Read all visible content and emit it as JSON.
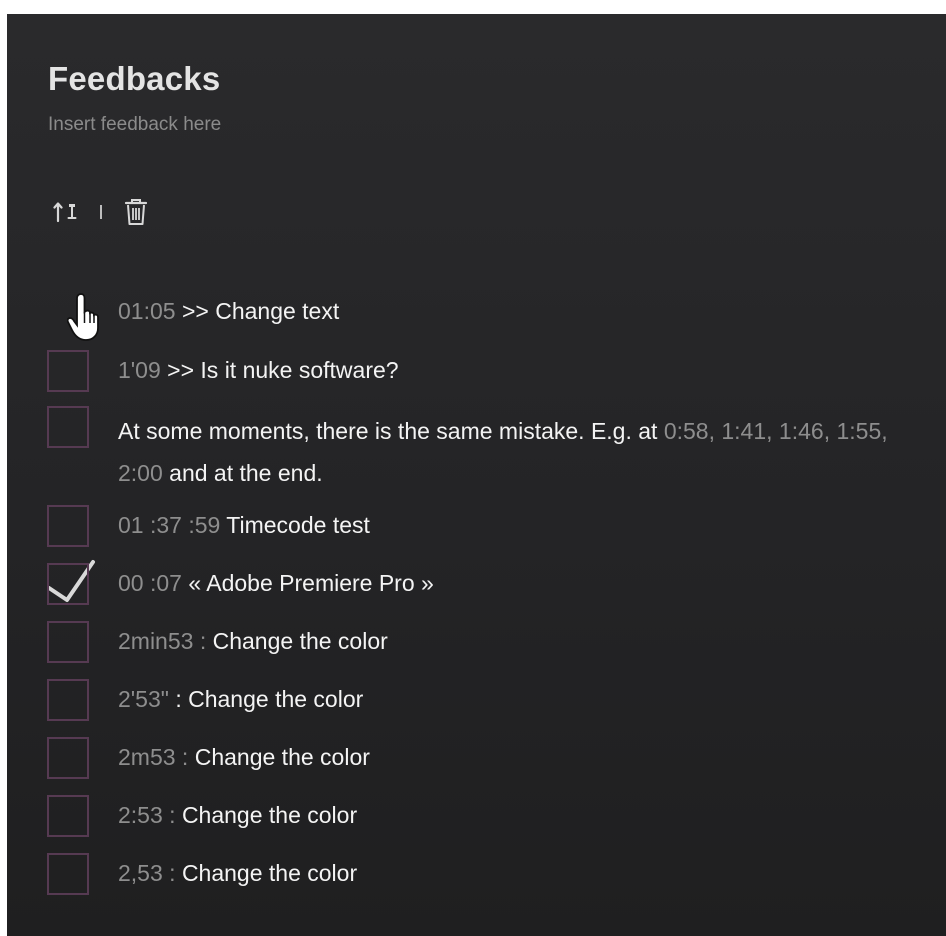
{
  "header": {
    "title": "Feedbacks",
    "placeholder": "Insert feedback here"
  },
  "toolbar": {
    "icons": [
      "sort-icon",
      "separator",
      "trash-icon"
    ]
  },
  "rows": [
    {
      "timecode": "01:05",
      "text": ">> Change text",
      "checked": true
    },
    {
      "timecode": "1'09",
      "text": ">> Is it nuke software?",
      "checked": false
    },
    {
      "timecode": "",
      "text": "",
      "checked": false
    },
    {
      "timecode": "01 :37 :59",
      "text": "Timecode test",
      "checked": false
    },
    {
      "timecode": "00 :07",
      "text": "« Adobe Premiere Pro »",
      "checked": false
    },
    {
      "timecode": "2min53 :",
      "text": "Change the color",
      "checked": false
    },
    {
      "timecode": "2'53\"",
      "text": ": Change the color",
      "checked": false
    },
    {
      "timecode": "2m53 :",
      "text": "Change the color",
      "checked": false
    },
    {
      "timecode": "2:53 :",
      "text": "Change the color",
      "checked": false
    },
    {
      "timecode": "2,53 :",
      "text": "Change the color",
      "checked": false
    }
  ],
  "multi_row": {
    "part1": "At some moments, there is the same mistake. E.g. at",
    "tc1": "0:58",
    "sep1": ",",
    "tc2": "1:41",
    "sep2": ",",
    "tc3": "1:46",
    "sep3": ",",
    "tc4": "1:55",
    "sep4": ",",
    "tc5": "2:00",
    "part2": "and at the end."
  },
  "colors": {
    "panel_bg": "#262628",
    "checkbox_border": "#563a52",
    "timecode": "#8e8e8e",
    "text": "#f4f4f4"
  }
}
